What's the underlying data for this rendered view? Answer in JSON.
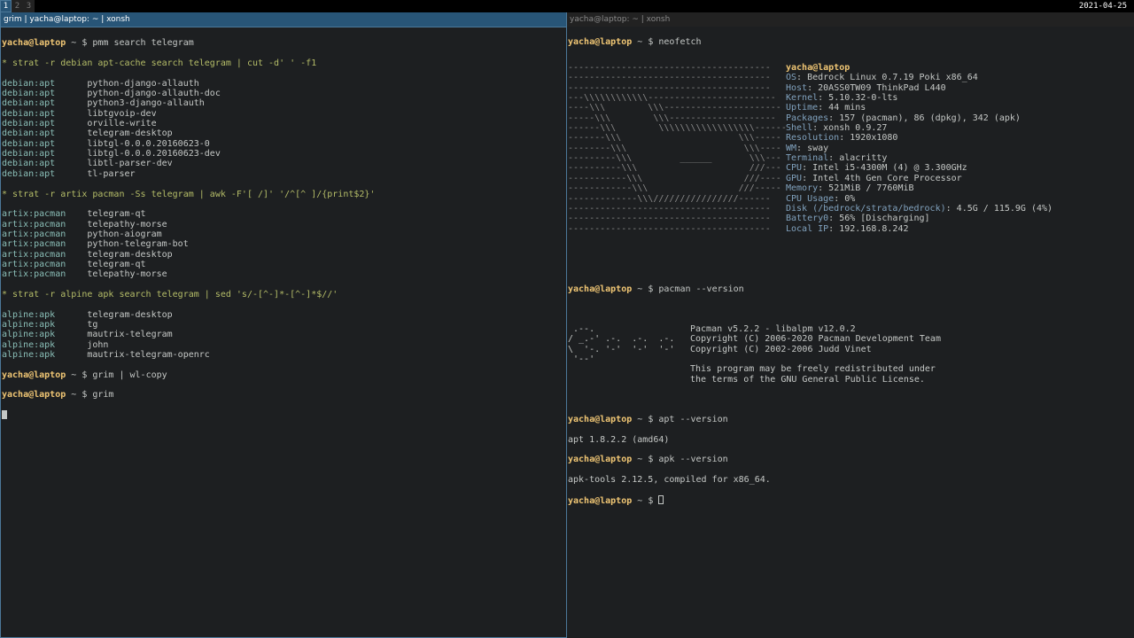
{
  "topbar": {
    "workspaces": [
      "1",
      "2",
      "3"
    ],
    "clock": "2021-04-25"
  },
  "left": {
    "title": "grim | yacha@laptop: ~ | xonsh",
    "prompt_user": "yacha@laptop",
    "commands": {
      "c1": "pmm search telegram",
      "c2": "grim | wl-copy",
      "c3": "grim"
    },
    "strats": {
      "s1": "strat -r debian apt-cache search telegram | cut -d' ' -f1",
      "s2": "strat -r artix pacman -Ss telegram | awk -F'[ /]' '/^[^ ]/{print$2}'",
      "s3": "strat -r alpine apk search telegram | sed 's/-[^-]*-[^-]*$//'"
    },
    "debian": [
      {
        "repo": "debian:apt",
        "pkg": "python-django-allauth"
      },
      {
        "repo": "debian:apt",
        "pkg": "python-django-allauth-doc"
      },
      {
        "repo": "debian:apt",
        "pkg": "python3-django-allauth"
      },
      {
        "repo": "debian:apt",
        "pkg": "libtgvoip-dev"
      },
      {
        "repo": "debian:apt",
        "pkg": "orville-write"
      },
      {
        "repo": "debian:apt",
        "pkg": "telegram-desktop"
      },
      {
        "repo": "debian:apt",
        "pkg": "libtgl-0.0.0.20160623-0"
      },
      {
        "repo": "debian:apt",
        "pkg": "libtgl-0.0.0.20160623-dev"
      },
      {
        "repo": "debian:apt",
        "pkg": "libtl-parser-dev"
      },
      {
        "repo": "debian:apt",
        "pkg": "tl-parser"
      }
    ],
    "artix": [
      {
        "repo": "artix:pacman",
        "pkg": "telegram-qt"
      },
      {
        "repo": "artix:pacman",
        "pkg": "telepathy-morse"
      },
      {
        "repo": "artix:pacman",
        "pkg": "python-aiogram"
      },
      {
        "repo": "artix:pacman",
        "pkg": "python-telegram-bot"
      },
      {
        "repo": "artix:pacman",
        "pkg": "telegram-desktop"
      },
      {
        "repo": "artix:pacman",
        "pkg": "telegram-qt"
      },
      {
        "repo": "artix:pacman",
        "pkg": "telepathy-morse"
      }
    ],
    "alpine": [
      {
        "repo": "alpine:apk",
        "pkg": "telegram-desktop"
      },
      {
        "repo": "alpine:apk",
        "pkg": "tg"
      },
      {
        "repo": "alpine:apk",
        "pkg": "mautrix-telegram"
      },
      {
        "repo": "alpine:apk",
        "pkg": "john"
      },
      {
        "repo": "alpine:apk",
        "pkg": "mautrix-telegram-openrc"
      }
    ]
  },
  "right": {
    "title": "yacha@laptop: ~ | xonsh",
    "prompt_user": "yacha@laptop",
    "commands": {
      "neofetch": "neofetch",
      "pacman": "pacman --version",
      "apt": "apt --version",
      "apk": "apk --version"
    },
    "logo_lines": [
      "--------------------------------------",
      "--------------------------------------",
      "--------------------------------------",
      "---\\\\\\\\\\\\\\\\\\\\\\\\------------------------",
      "----\\\\\\        \\\\\\----------------------",
      "-----\\\\\\        \\\\\\--------------------",
      "------\\\\\\        \\\\\\\\\\\\\\\\\\\\\\\\\\\\\\\\\\\\------",
      "-------\\\\\\                      \\\\\\-----",
      "--------\\\\\\                      \\\\\\----",
      "---------\\\\\\         ______       \\\\\\---",
      "----------\\\\\\                     ///---",
      "-----------\\\\\\                   ///----",
      "------------\\\\\\                 ///-----",
      "-------------\\\\\\////////////////------",
      "--------------------------------------",
      "--------------------------------------",
      "--------------------------------------"
    ],
    "neofetch": {
      "user": "yacha@laptop",
      "rows": [
        {
          "key": "OS",
          "val": "Bedrock Linux 0.7.19 Poki x86_64"
        },
        {
          "key": "Host",
          "val": "20ASS0TW09 ThinkPad L440"
        },
        {
          "key": "Kernel",
          "val": "5.10.32-0-lts"
        },
        {
          "key": "Uptime",
          "val": "44 mins"
        },
        {
          "key": "Packages",
          "val": "157 (pacman), 86 (dpkg), 342 (apk)"
        },
        {
          "key": "Shell",
          "val": "xonsh 0.9.27"
        },
        {
          "key": "Resolution",
          "val": "1920x1080"
        },
        {
          "key": "WM",
          "val": "sway"
        },
        {
          "key": "Terminal",
          "val": "alacritty"
        },
        {
          "key": "CPU",
          "val": "Intel i5-4300M (4) @ 3.300GHz"
        },
        {
          "key": "GPU",
          "val": "Intel 4th Gen Core Processor"
        },
        {
          "key": "Memory",
          "val": "521MiB / 7760MiB"
        },
        {
          "key": "CPU Usage",
          "val": "0%"
        },
        {
          "key": "Disk (/bedrock/strata/bedrock)",
          "val": "4.5G / 115.9G (4%)"
        },
        {
          "key": "Battery0",
          "val": "56% [Discharging]"
        },
        {
          "key": "Local IP",
          "val": "192.168.8.242"
        }
      ]
    },
    "pacman_logo": [
      " .--.",
      "/ _.-' .-.  .-.  .-.",
      "\\  '-. '-'  '-'  '-'",
      " '--'",
      ""
    ],
    "pacman_text": [
      "Pacman v5.2.2 - libalpm v12.0.2",
      "Copyright (C) 2006-2020 Pacman Development Team",
      "Copyright (C) 2002-2006 Judd Vinet",
      "",
      "This program may be freely redistributed under",
      "the terms of the GNU General Public License."
    ],
    "apt_out": "apt 1.8.2.2 (amd64)",
    "apk_out": "apk-tools 2.12.5, compiled for x86_64."
  }
}
